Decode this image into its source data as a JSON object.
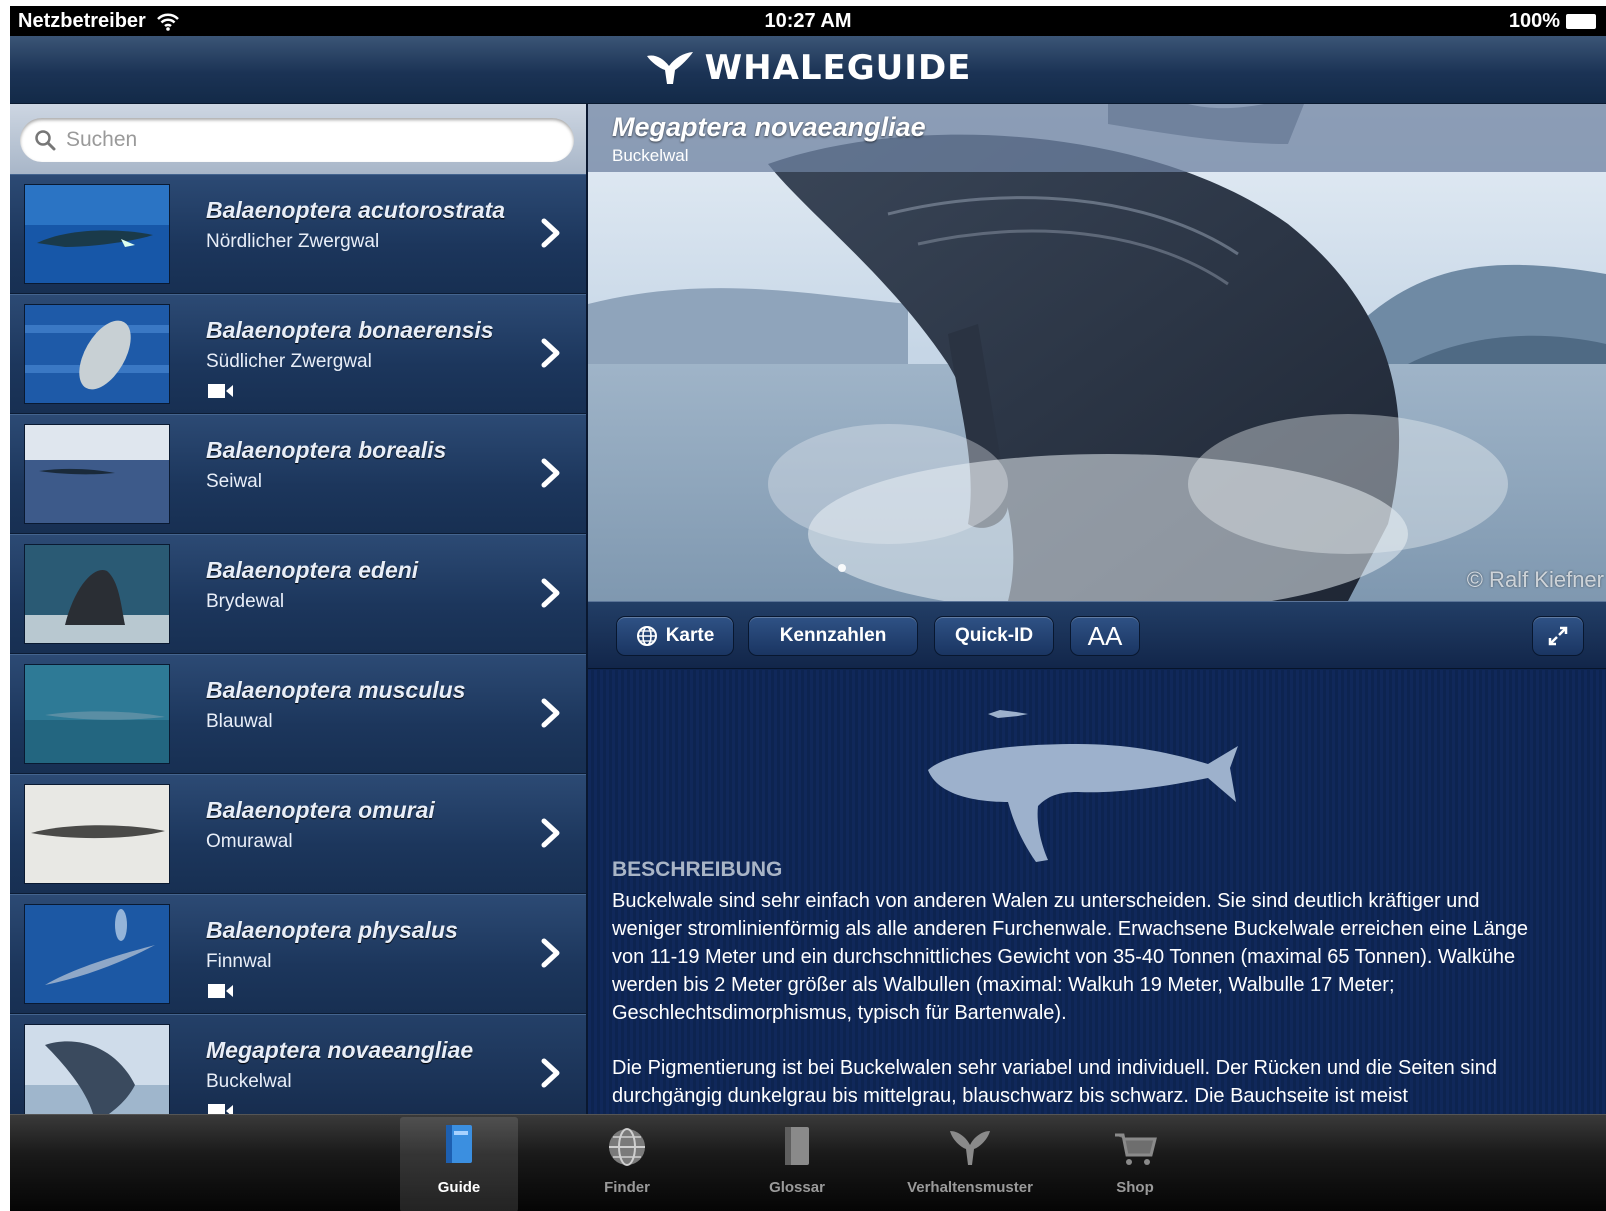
{
  "status_bar": {
    "carrier": "Netzbetreiber",
    "time": "10:27 AM",
    "battery": "100%"
  },
  "nav": {
    "title": "WHALEGUIDE"
  },
  "search": {
    "placeholder": "Suchen"
  },
  "species": [
    {
      "latin": "Balaenoptera acutorostrata",
      "common": "Nördlicher Zwergwal",
      "has_video": false
    },
    {
      "latin": "Balaenoptera bonaerensis",
      "common": "Südlicher Zwergwal",
      "has_video": true
    },
    {
      "latin": "Balaenoptera borealis",
      "common": "Seiwal",
      "has_video": false
    },
    {
      "latin": "Balaenoptera edeni",
      "common": "Brydewal",
      "has_video": false
    },
    {
      "latin": "Balaenoptera musculus",
      "common": "Blauwal",
      "has_video": false
    },
    {
      "latin": "Balaenoptera omurai",
      "common": "Omurawal",
      "has_video": false
    },
    {
      "latin": "Balaenoptera physalus",
      "common": "Finnwal",
      "has_video": true
    },
    {
      "latin": "Megaptera novaeangliae",
      "common": "Buckelwal",
      "has_video": true,
      "selected": true
    }
  ],
  "detail": {
    "title": "Megaptera novaeangliae",
    "common": "Buckelwal",
    "photo_credit": "© Ralf Kiefner",
    "toolbar": {
      "map": "Karte",
      "facts": "Kennzahlen",
      "quick_id": "Quick-ID",
      "font_size": "AA"
    },
    "section_heading": "BESCHREIBUNG",
    "paragraphs": [
      "Buckelwale sind sehr einfach von anderen Walen zu unterscheiden. Sie sind deutlich kräftiger und weniger stromlinienförmig als alle anderen Furchenwale. Erwachsene Buckelwale erreichen eine Länge von 11-19 Meter und ein durchschnittliches Gewicht von 35-40 Tonnen (maximal 65 Tonnen). Walkühe werden bis 2 Meter größer als Walbullen (maximal: Walkuh 19 Meter, Walbulle 17 Meter; Geschlechtsdimorphismus, typisch für Bartenwale).",
      "Die Pigmentierung ist bei Buckelwalen sehr variabel und individuell. Der Rücken und die Seiten sind durchgängig dunkelgrau bis mittelgrau, blauschwarz bis schwarz. Die Bauchseite ist meist"
    ]
  },
  "tabs": [
    {
      "label": "Guide",
      "icon": "book-icon",
      "active": true
    },
    {
      "label": "Finder",
      "icon": "globe-icon",
      "active": false
    },
    {
      "label": "Glossar",
      "icon": "glossary-book-icon",
      "active": false
    },
    {
      "label": "Verhaltensmuster",
      "icon": "whale-tail-icon",
      "active": false
    },
    {
      "label": "Shop",
      "icon": "cart-icon",
      "active": false
    }
  ],
  "colors": {
    "nav": "#1b3355",
    "list_row": "#1c365c",
    "detail_bg": "#0e2550",
    "tab_bar": "#1a1a1a"
  }
}
